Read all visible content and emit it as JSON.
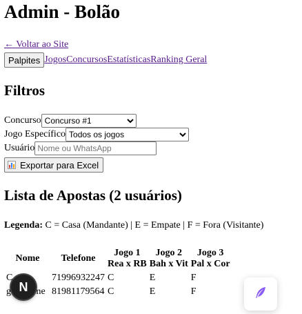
{
  "header": {
    "title": "Admin - Bolão"
  },
  "nav": {
    "back_link": "← Voltar ao Site",
    "tabs": {
      "palpites": "Palpites",
      "jogos": "Jogos",
      "concursos": "Concursos",
      "estatisticas": "Estatísticas",
      "ranking": "Ranking Geral"
    }
  },
  "filters": {
    "heading": "Filtros",
    "concurso_label": "Concurso",
    "concurso_selected": "Concurso #1",
    "jogo_label": "Jogo Específico",
    "jogo_selected": "Todos os jogos",
    "usuario_label": "Usuário",
    "usuario_placeholder": "Nome ou WhatsApp",
    "usuario_value": "",
    "export_label": "Exportar para Excel",
    "export_icon": "chart-icon"
  },
  "list": {
    "heading": "Lista de Apostas (2 usuários)",
    "legend_label": "Legenda:",
    "legend_text": " C = Casa (Mandante) | E = Empate | F = Fora (Visitante)",
    "columns": {
      "nome": "Nome",
      "telefone": "Telefone",
      "jogo1_title": "Jogo 1",
      "jogo1_teams": "Rea x RB",
      "jogo2_title": "Jogo 2",
      "jogo2_teams": "Bah x Vit",
      "jogo3_title": "Jogo 3",
      "jogo3_teams": "Pal x Cor"
    },
    "rows": [
      {
        "nome": "C",
        "telefone": "71996932247",
        "jogo1": "C",
        "jogo2": "E",
        "jogo3": "F"
      },
      {
        "nome": "guilherme",
        "telefone": "81981179564",
        "jogo1": "C",
        "jogo2": "E",
        "jogo3": "F"
      }
    ]
  },
  "overlay": {
    "fab_letter": "N",
    "chat_icon": "feather-icon",
    "colors": {
      "link": "#551a8b",
      "fab_bg": "#1f1f1f",
      "feather": "#8b5cf6"
    }
  }
}
